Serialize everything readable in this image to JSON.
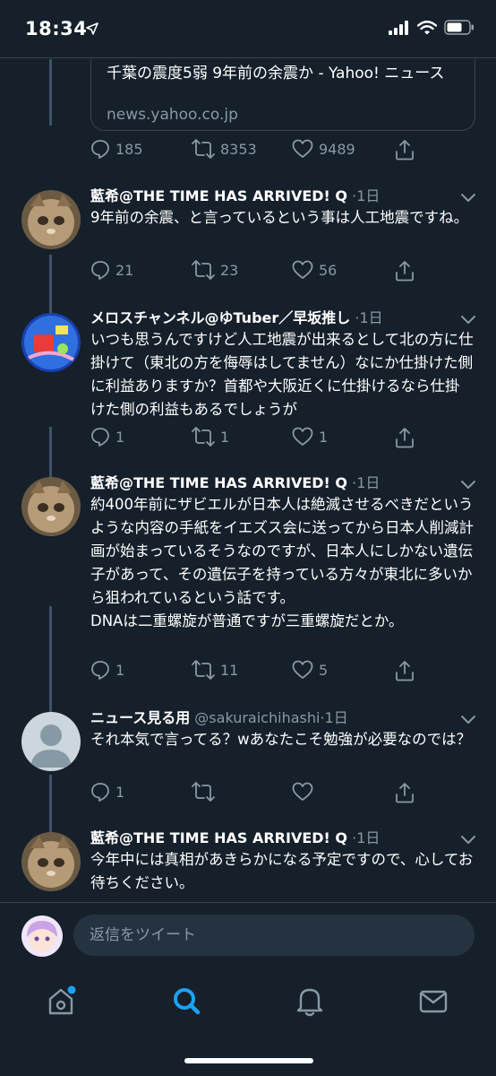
{
  "status": {
    "time": "18:34"
  },
  "link_card": {
    "title": "千葉の震度5弱 9年前の余震か - Yahoo! ニュース",
    "domain": "news.yahoo.co.jp"
  },
  "main_actions": {
    "replies": "185",
    "retweets": "8353",
    "likes": "9489"
  },
  "tweets": [
    {
      "name": "藍希@THE TIME HAS ARRIVED! Q",
      "meta": "·1日",
      "text": "9年前の余震、と言っているという事は人工地震ですね。",
      "replies": "21",
      "retweets": "23",
      "likes": "56"
    },
    {
      "name": "メロスチャンネル@ゆTuber／早坂推し",
      "meta": "·1日",
      "text": "いつも思うんですけど人工地震が出来るとして北の方に仕掛けて（東北の方を侮辱はしてません）なにか仕掛けた側に利益ありますか？首都や大阪近くに仕掛けるなら仕掛けた側の利益もあるでしょうが",
      "replies": "1",
      "retweets": "1",
      "likes": "1"
    },
    {
      "name": "藍希@THE TIME HAS ARRIVED! Q",
      "meta": "·1日",
      "text": "約400年前にザビエルが日本人は絶滅させるべきだというような内容の手紙をイエズス会に送ってから日本人削減計画が始まっているそうなのですが、日本人にしかない遺伝子があって、その遺伝子を持っている方々が東北に多いから狙われているという話です。\nDNAは二重螺旋が普通ですが三重螺旋だとか。",
      "replies": "1",
      "retweets": "11",
      "likes": "5"
    },
    {
      "name": "ニュース見る用",
      "meta": "@sakuraichihashi·1日",
      "text": "それ本気で言ってる？wあなたこそ勉強が必要なのでは？",
      "replies": "1",
      "retweets": "",
      "likes": ""
    },
    {
      "name": "藍希@THE TIME HAS ARRIVED! Q",
      "meta": "·1日",
      "text": "今年中には真相があきらかになる予定ですので、心してお待ちください。"
    }
  ],
  "reply_bar": {
    "placeholder": "返信をツイート"
  },
  "icons": {
    "status": [
      "location-arrow-icon",
      "signal-icon",
      "wifi-icon",
      "battery-icon"
    ],
    "actions": [
      "reply-icon",
      "retweet-icon",
      "like-icon",
      "share-icon"
    ],
    "tabs": [
      "home-icon",
      "search-icon",
      "notifications-icon",
      "messages-icon"
    ]
  },
  "colors": {
    "background": "#15202b",
    "text": "#ffffff",
    "secondary": "#8899a6",
    "accent": "#1da1f2",
    "divider": "#38444d",
    "thread_line": "#3d5466"
  }
}
